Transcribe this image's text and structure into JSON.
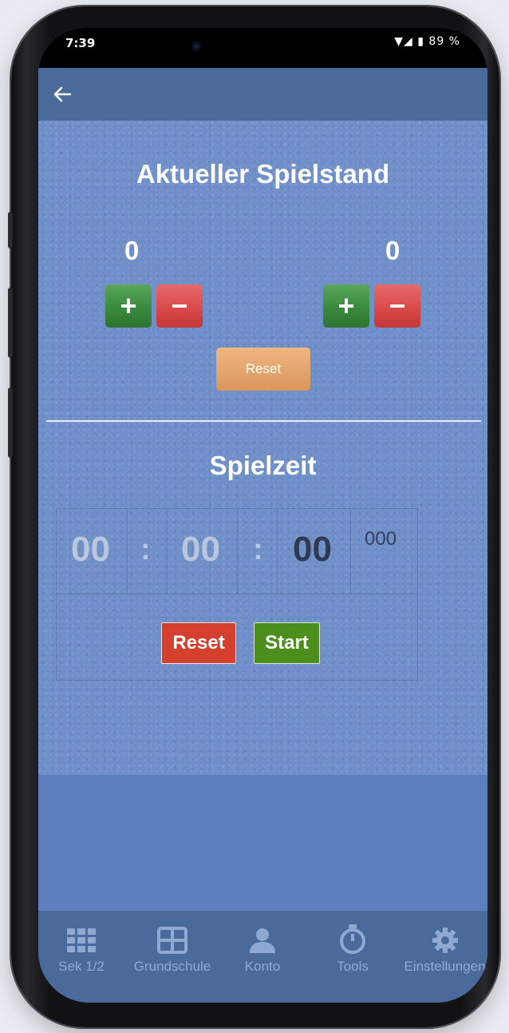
{
  "status": {
    "time": "7:39",
    "battery": "89 %"
  },
  "appbar": {
    "back_icon": "arrow-left-icon"
  },
  "score": {
    "title": "Aktueller Spielstand",
    "team_left": "0",
    "team_right": "0",
    "plus": "+",
    "minus": "−",
    "reset_label": "Reset"
  },
  "timer": {
    "title": "Spielzeit",
    "hours": "00",
    "minutes": "00",
    "seconds": "00",
    "milliseconds": "000",
    "separator": ":",
    "reset_label": "Reset",
    "start_label": "Start"
  },
  "tabs": [
    {
      "label": "Sek 1/2",
      "icon": "grid-icon"
    },
    {
      "label": "Grundschule",
      "icon": "window-icon"
    },
    {
      "label": "Konto",
      "icon": "user-icon"
    },
    {
      "label": "Tools",
      "icon": "stopwatch-icon"
    },
    {
      "label": "Einstellungen",
      "icon": "gear-icon"
    }
  ],
  "colors": {
    "appbar": "#4a6a9c",
    "background": "#6f8fc8",
    "plus": "#3a8a3e",
    "minus": "#d94a4a",
    "reset_score": "#e2a36b",
    "timer_reset": "#d53f2e",
    "timer_start": "#4b8e1c"
  }
}
